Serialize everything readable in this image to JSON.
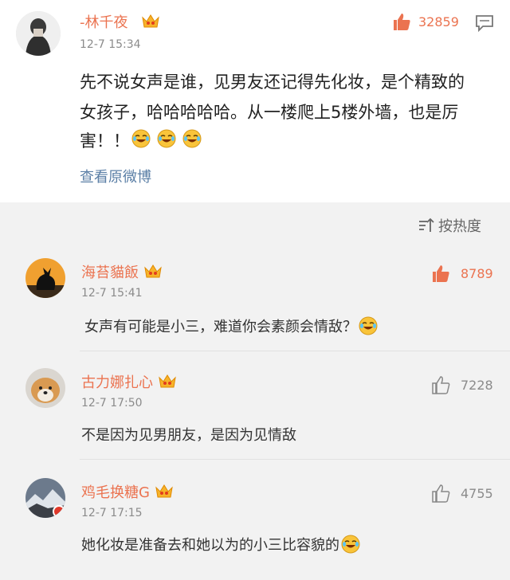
{
  "main_post": {
    "username": "-林千夜",
    "time": "12-7 15:34",
    "likes": "32859",
    "line1": "先不说女声是谁，见男友还记得先化妆，是个精致的",
    "line2": "女孩子，哈哈哈哈哈。从一楼爬上5楼外墙，也是厉",
    "line3": "害！！",
    "view_original": "查看原微博"
  },
  "sort": {
    "label": "按热度"
  },
  "comments": [
    {
      "username": "海苔貓飯",
      "time": "12-7 15:41",
      "likes": "8789",
      "text": "女声有可能是小三，难道你会素颜会情敌？"
    },
    {
      "username": "古力娜扎心",
      "time": "12-7 17:50",
      "likes": "7228",
      "text": "不是因为见男朋友，是因为见情敌"
    },
    {
      "username": "鸡毛换糖G",
      "time": "12-7 17:15",
      "likes": "4755",
      "text": "她化妆是准备去和她以为的小三比容貌的"
    }
  ],
  "colors": {
    "accent": "#eb7350",
    "link": "#5b7fa6",
    "gray": "#8b8b8b"
  }
}
